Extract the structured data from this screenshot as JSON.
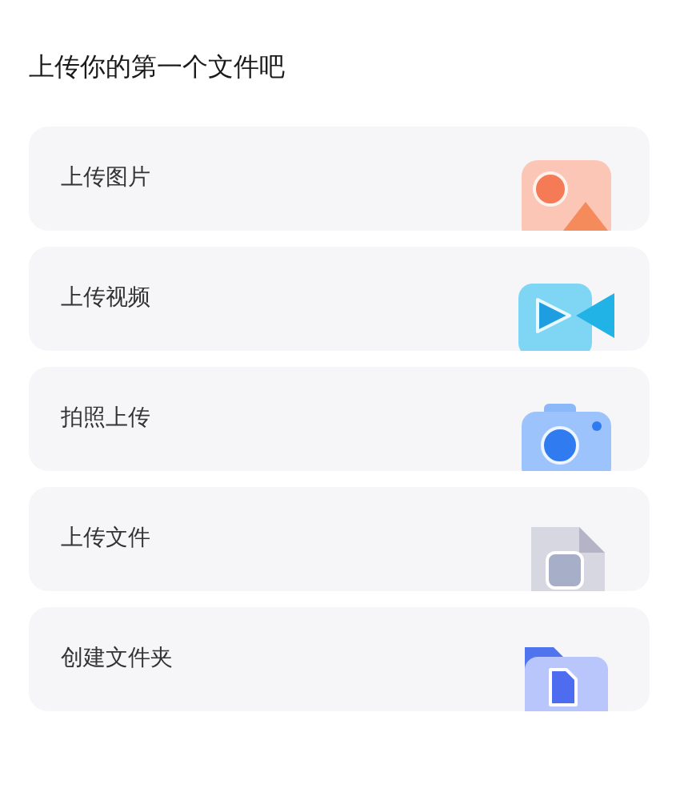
{
  "title": "上传你的第一个文件吧",
  "options": [
    {
      "label": "上传图片",
      "kind": "image"
    },
    {
      "label": "上传视频",
      "kind": "video"
    },
    {
      "label": "拍照上传",
      "kind": "camera"
    },
    {
      "label": "上传文件",
      "kind": "file"
    },
    {
      "label": "创建文件夹",
      "kind": "folder"
    }
  ]
}
